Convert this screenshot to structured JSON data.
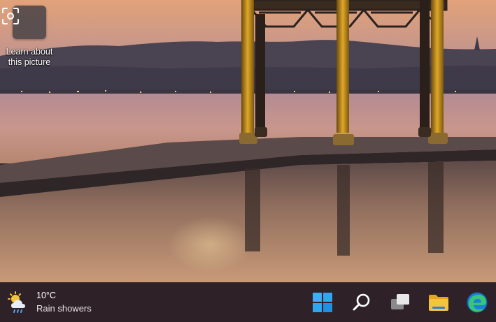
{
  "desktop": {
    "learn_icon": {
      "label": "Learn about this picture",
      "icon": "camera-focus-icon"
    }
  },
  "taskbar": {
    "weather": {
      "temperature": "10°C",
      "condition": "Rain showers",
      "icon": "sun-cloud-rain-icon"
    },
    "buttons": [
      {
        "name": "Start",
        "icon": "windows-logo-icon"
      },
      {
        "name": "Search",
        "icon": "search-icon"
      },
      {
        "name": "Task View",
        "icon": "task-view-icon"
      },
      {
        "name": "File Explorer",
        "icon": "folder-icon"
      },
      {
        "name": "Microsoft Edge",
        "icon": "edge-icon"
      }
    ]
  },
  "colors": {
    "taskbar_bg": "#2e2228",
    "windows_blue": "#2ea6f0",
    "folder_yellow": "#f5c342"
  }
}
